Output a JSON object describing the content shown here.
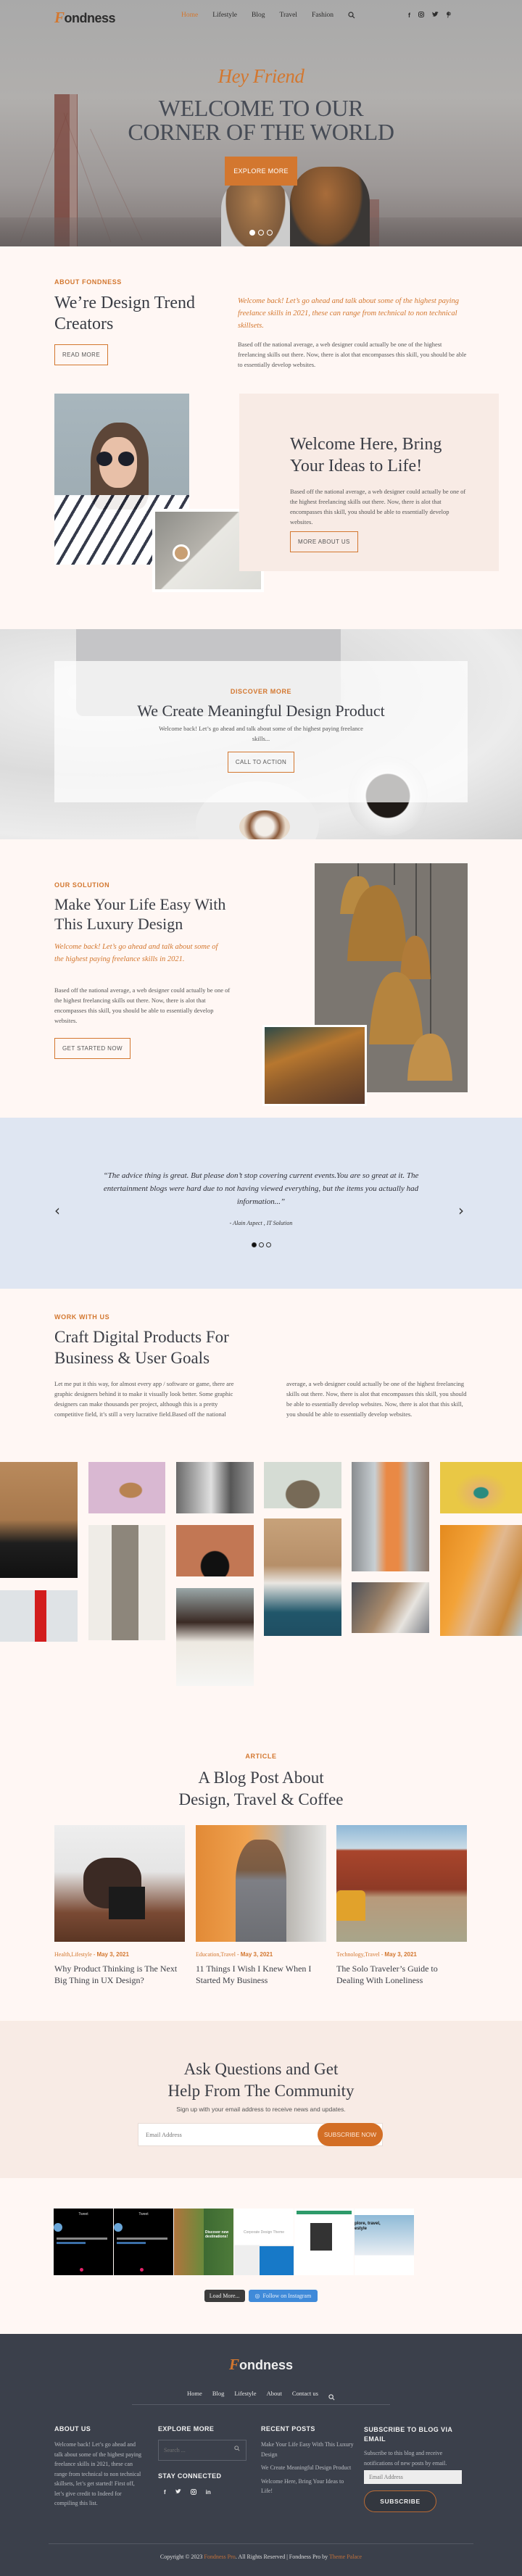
{
  "brand": {
    "logo_initial": "F",
    "logo_rest": "ondness",
    "accent_color": "#d3772f"
  },
  "nav": {
    "items": [
      {
        "label": "Home",
        "active": true
      },
      {
        "label": "Lifestyle",
        "active": false
      },
      {
        "label": "Blog",
        "active": false
      },
      {
        "label": "Travel",
        "active": false
      },
      {
        "label": "Fashion",
        "active": false
      }
    ],
    "search_icon": "search-icon",
    "social": [
      {
        "icon": "facebook-icon",
        "glyph": "f"
      },
      {
        "icon": "instagram-icon",
        "glyph": "◎"
      },
      {
        "icon": "twitter-icon",
        "glyph": "🐦"
      },
      {
        "icon": "pinterest-icon",
        "glyph": "℗"
      }
    ]
  },
  "hero": {
    "script": "Hey Friend",
    "title_line1": "WELCOME TO OUR",
    "title_line2": "CORNER OF THE WORLD",
    "button": "EXPLORE MORE",
    "slides": 3,
    "active_slide": 1
  },
  "about": {
    "eyebrow": "ABOUT FONDNESS",
    "title": "We’re Design Trend Creators",
    "button": "READ MORE",
    "lead": "Welcome back! Let’s go ahead and talk about some of the highest paying freelance skills in 2021, these can range from technical to non technical skillsets.",
    "body": "Based off the national average, a web designer could actually be one of the highest freelancing skills out there. Now, there is alot that encompasses this skill, you should be able to essentially develop websites."
  },
  "welcome": {
    "title": "Welcome Here, Bring Your Ideas to Life!",
    "body": "Based off the national average, a web designer could actually be one of the highest freelancing skills out there. Now, there is alot that encompasses this skill, you should be able to essentially develop websites.",
    "button": "MORE ABOUT US"
  },
  "discover": {
    "eyebrow": "DISCOVER MORE",
    "title": "We Create Meaningful Design Product",
    "body": "Welcome back! Let’s go ahead and talk about some of the highest paying freelance skills...",
    "button": "CALL TO ACTION"
  },
  "solution": {
    "eyebrow": "OUR SOLUTION",
    "title": "Make Your Life Easy With This Luxury Design",
    "lead": "Welcome back! Let’s go ahead and talk about some of the highest paying freelance skills in 2021.",
    "body": "Based off the national average, a web designer could actually be one of the highest freelancing skills out there. Now, there is alot that encompasses this skill, you should be able to essentially develop websites.",
    "button": "GET STARTED NOW"
  },
  "testimonial": {
    "quote": "“The advice thing is great. But please don’t stop covering current events.You are so great at it. The entertainment blogs were hard due to not having viewed everything, but the items you actually had information...”",
    "author": "- Alain Aspect , IT Solution",
    "prev": "‹",
    "next": "›",
    "slides": 3,
    "active_slide": 1
  },
  "work": {
    "eyebrow": "WORK WITH US",
    "title": "Craft Digital Products For Business & User Goals",
    "col1": "Let me put it this way, for almost every app / software or game, there are graphic designers behind it to make it visually look better. Some graphic designers can make thousands per project, although this is a pretty competitive field, it’s still a very lucrative field.Based off the national",
    "col2": "average, a web designer could actually be one of the highest freelancing skills out there. Now, there is alot that encompasses this skill, you should be able to essentially develop websites. Now, there is alot that this skill, you should be able to essentially develop websites."
  },
  "articles": {
    "eyebrow": "ARTICLE",
    "title_line1": "A Blog Post About",
    "title_line2": "Design, Travel & Coffee",
    "posts": [
      {
        "categories": "Health,Lifestyle",
        "date": "May 3, 2021",
        "title": "Why Product Thinking is The Next Big Thing in UX Design?"
      },
      {
        "categories": "Education,Travel",
        "date": "May 3, 2021",
        "title": "11 Things I Wish I Knew When I Started My Business"
      },
      {
        "categories": "Technology,Travel",
        "date": "May 3, 2021",
        "title": "The Solo Traveler’s Guide to Dealing With Loneliness"
      }
    ]
  },
  "newsletter": {
    "title_line1": "Ask Questions and Get",
    "title_line2": "Help From The Community",
    "subtitle": "Sign up with your email address to receive news and updates.",
    "placeholder": "Email Address",
    "button": "SUBSCRIBE NOW"
  },
  "instagram": {
    "load_more": "Load More...",
    "follow": "Follow on Instagram",
    "thumb_texts": [
      "Tweet",
      "Tweet",
      "Discover new destinations!",
      "Corporate Design Theme",
      "",
      "plore, travel, estyle"
    ]
  },
  "footer": {
    "nav": [
      "Home",
      "Blog",
      "Lifestyle",
      "About",
      "Contact us"
    ],
    "about_title": "ABOUT US",
    "about_text": "Welcome back! Let’s go ahead and talk about some of the highest paying freelance skills in 2021, these can range from technical to non technical skillsets, let’s get started! First off, let’s give credit to Indeed for compiling this list.",
    "explore_title": "EXPLORE MORE",
    "search_placeholder": "Search ...",
    "stay_title": "STAY CONNECTED",
    "social": [
      {
        "icon": "facebook-icon",
        "glyph": "f"
      },
      {
        "icon": "twitter-icon",
        "glyph": "🐦"
      },
      {
        "icon": "instagram-icon",
        "glyph": "◎"
      },
      {
        "icon": "linkedin-icon",
        "glyph": "in"
      }
    ],
    "recent_title": "RECENT POSTS",
    "recent_posts": [
      "Make Your Life Easy With This Luxury Design",
      "We Create Meaningful Design Product",
      "Welcome Here, Bring Your Ideas to Life!"
    ],
    "subscribe_title": "SUBSCRIBE TO BLOG VIA EMAIL",
    "subscribe_text": "Subscribe to this blog and receive notifications of new posts by email.",
    "email_placeholder": "Email Address",
    "subscribe_button": "SUBSCRIBE",
    "copyright_pre": "Copyright © 2023 ",
    "copyright_link1": "Fondness Pro",
    "copyright_mid": ". All Rights Reserved | Fondness Pro by ",
    "copyright_link2": "Theme Palace"
  }
}
